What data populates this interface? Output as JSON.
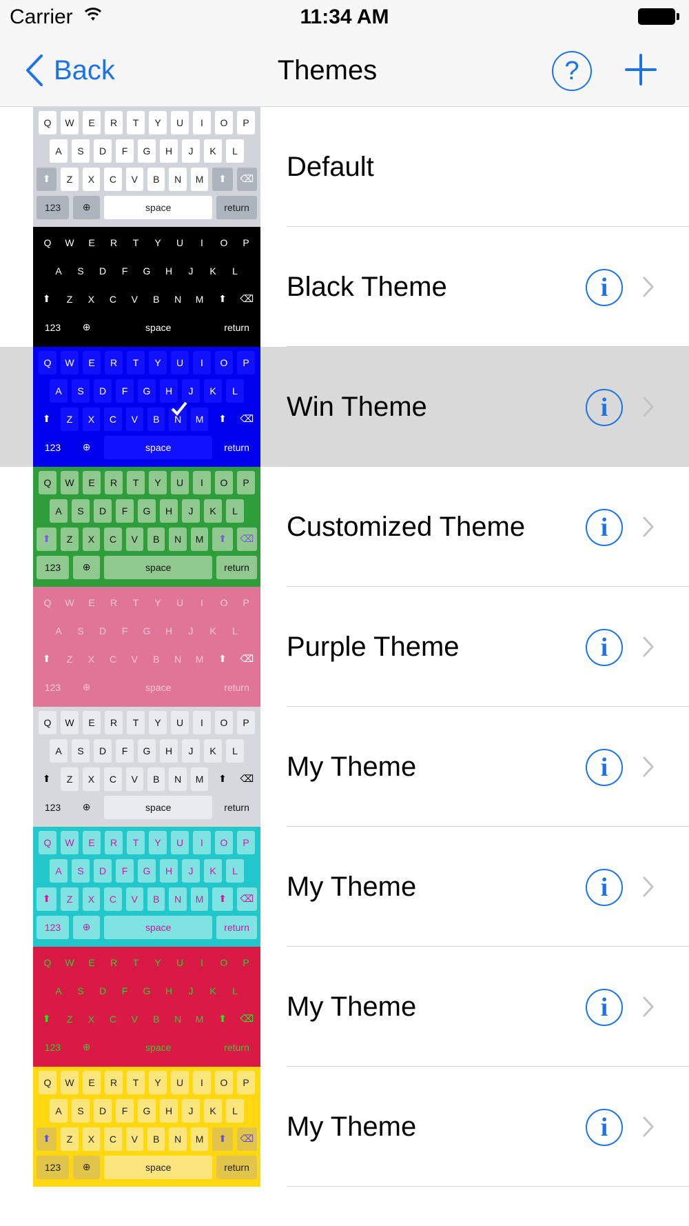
{
  "status": {
    "carrier": "Carrier",
    "time": "11:34 AM"
  },
  "nav": {
    "back_label": "Back",
    "title": "Themes",
    "help_label": "?"
  },
  "keyboard": {
    "row1": [
      "Q",
      "W",
      "E",
      "R",
      "T",
      "Y",
      "U",
      "I",
      "O",
      "P"
    ],
    "row2": [
      "A",
      "S",
      "D",
      "F",
      "G",
      "H",
      "J",
      "K",
      "L"
    ],
    "row3": [
      "Z",
      "X",
      "C",
      "V",
      "B",
      "N",
      "M"
    ],
    "numbers_key": "123",
    "space_key": "space",
    "return_key": "return"
  },
  "themes": [
    {
      "name": "Default",
      "info": false,
      "selected": false,
      "colors": {
        "bg": "#d1d5db",
        "key": "#ffffff",
        "mod": "#aeb4bd",
        "text": "#222222",
        "modtext": "#ffffff"
      }
    },
    {
      "name": "Black Theme",
      "info": true,
      "selected": false,
      "colors": {
        "bg": "#000000",
        "key": "#000000",
        "mod": "#000000",
        "text": "#ffffff",
        "modtext": "#ffffff"
      }
    },
    {
      "name": "Win Theme",
      "info": true,
      "selected": true,
      "colors": {
        "bg": "#0000ee",
        "key": "#1111ff",
        "mod": "#0000ee",
        "text": "#ffffff",
        "modtext": "#ffffff"
      }
    },
    {
      "name": "Customized Theme",
      "info": true,
      "selected": false,
      "colors": {
        "bg": "#2e9e3a",
        "key": "#8fc98f",
        "mod": "#8fc98f",
        "text": "#111111",
        "modtext": "#7b5bd6"
      }
    },
    {
      "name": "Purple Theme",
      "info": true,
      "selected": false,
      "colors": {
        "bg": "#e07598",
        "key": "#e07598",
        "mod": "#e07598",
        "text": "#f4c8d6",
        "modtext": "#ffffff"
      }
    },
    {
      "name": "My Theme",
      "info": true,
      "selected": false,
      "colors": {
        "bg": "#d6d9dc",
        "key": "#e9ebee",
        "mod": "#d6d9dc",
        "text": "#111111",
        "modtext": "#000000"
      }
    },
    {
      "name": "My Theme",
      "info": true,
      "selected": false,
      "colors": {
        "bg": "#22c7cc",
        "key": "#7fe3e2",
        "mod": "#7fe3e2",
        "text": "#d1189a",
        "modtext": "#d1189a"
      }
    },
    {
      "name": "My Theme",
      "info": true,
      "selected": false,
      "colors": {
        "bg": "#d81a45",
        "key": "#d81a45",
        "mod": "#d81a45",
        "text": "#33cc33",
        "modtext": "#22ee22"
      }
    },
    {
      "name": "My Theme",
      "info": true,
      "selected": false,
      "colors": {
        "bg": "#ffd812",
        "key": "#fbe57d",
        "mod": "#e0c54a",
        "text": "#222222",
        "modtext": "#6a4ad6"
      }
    }
  ],
  "colors": {
    "accent": "#1a73e8",
    "selected_row": "#d9d9d9",
    "separator": "#d2d2d2"
  }
}
